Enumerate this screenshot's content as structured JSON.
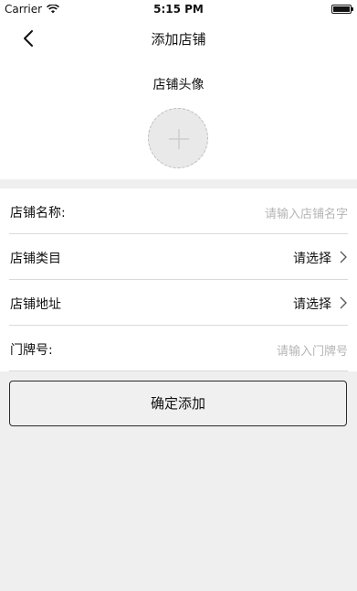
{
  "status_bar": {
    "carrier": "Carrier",
    "time": "5:15 PM"
  },
  "nav": {
    "title": "添加店铺"
  },
  "avatar": {
    "label": "店铺头像"
  },
  "form": {
    "name": {
      "label": "店铺名称:",
      "placeholder": "请输入店铺名字"
    },
    "category": {
      "label": "店铺类目",
      "value": "请选择"
    },
    "address": {
      "label": "店铺地址",
      "value": "请选择"
    },
    "house_number": {
      "label": "门牌号:",
      "placeholder": "请输入门牌号"
    }
  },
  "confirm_label": "确定添加"
}
